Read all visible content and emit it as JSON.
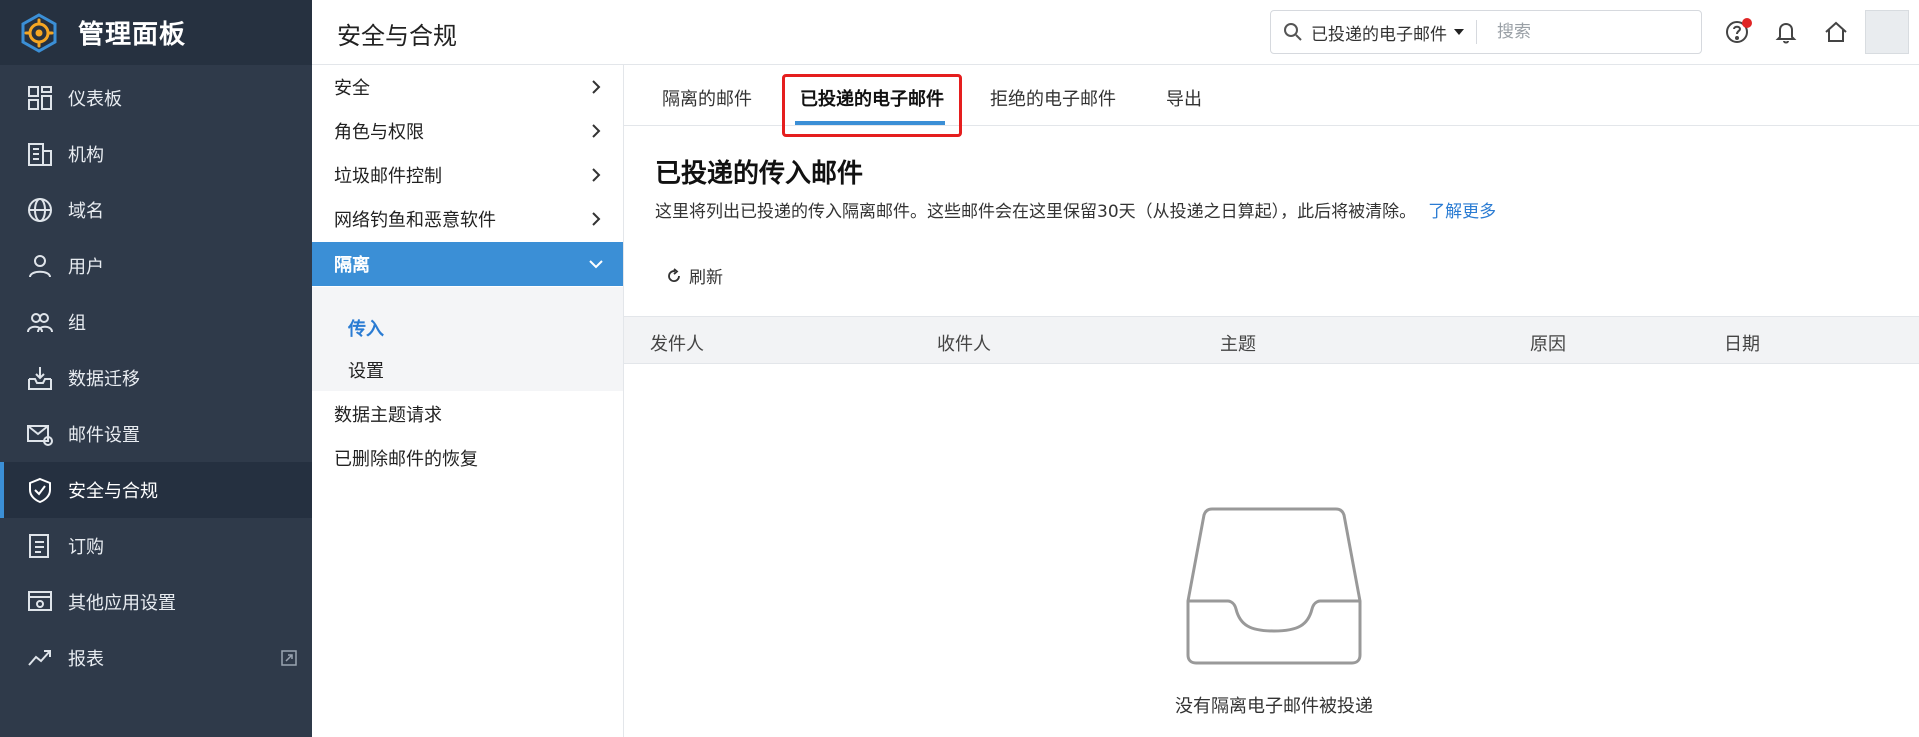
{
  "app": {
    "title": "管理面板"
  },
  "nav": {
    "items": [
      {
        "label": "仪表板",
        "icon": "dashboard-icon"
      },
      {
        "label": "机构",
        "icon": "building-icon"
      },
      {
        "label": "域名",
        "icon": "globe-icon"
      },
      {
        "label": "用户",
        "icon": "user-icon"
      },
      {
        "label": "组",
        "icon": "group-icon"
      },
      {
        "label": "数据迁移",
        "icon": "inbox-download-icon"
      },
      {
        "label": "邮件设置",
        "icon": "mail-settings-icon"
      },
      {
        "label": "安全与合规",
        "icon": "shield-check-icon",
        "active": true
      },
      {
        "label": "订购",
        "icon": "order-list-icon"
      },
      {
        "label": "其他应用设置",
        "icon": "app-settings-icon"
      },
      {
        "label": "报表",
        "icon": "trend-chart-icon"
      }
    ]
  },
  "header": {
    "title": "安全与合规",
    "search": {
      "scope": "已投递的电子邮件",
      "placeholder": "搜索"
    }
  },
  "submenu": {
    "items": [
      {
        "label": "安全"
      },
      {
        "label": "角色与权限"
      },
      {
        "label": "垃圾邮件控制"
      },
      {
        "label": "网络钓鱼和恶意软件"
      },
      {
        "label": "隔离",
        "expanded": true
      }
    ],
    "sub_items": [
      {
        "label": "传入",
        "active": true
      },
      {
        "label": "设置"
      }
    ],
    "bottom_items": [
      {
        "label": "数据主题请求"
      },
      {
        "label": "已删除邮件的恢复"
      }
    ]
  },
  "main": {
    "tabs": [
      {
        "label": "隔离的邮件"
      },
      {
        "label": "已投递的电子邮件",
        "active": true
      },
      {
        "label": "拒绝的电子邮件"
      },
      {
        "label": "导出"
      }
    ],
    "section_title": "已投递的传入邮件",
    "description": "这里将列出已投递的传入隔离邮件。这些邮件会在这里保留30天（从投递之日算起），此后将被清除。",
    "learn_more": "了解更多",
    "refresh_label": "刷新",
    "columns": [
      "发件人",
      "收件人",
      "主题",
      "原因",
      "日期"
    ],
    "empty_message": "没有隔离电子邮件被投递"
  },
  "colors": {
    "nav_bg": "#2f3a4a",
    "accent": "#3b8fd6",
    "highlight": "#e51e1e",
    "link": "#2b7cd3"
  }
}
